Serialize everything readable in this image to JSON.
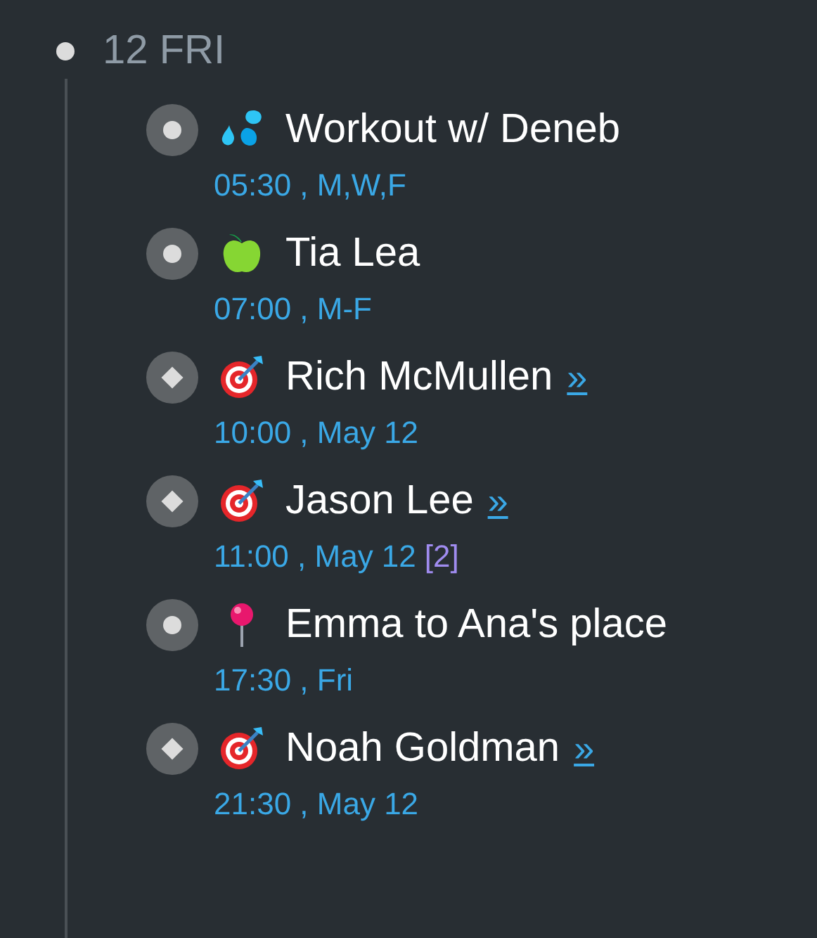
{
  "day": {
    "label": "12 FRI"
  },
  "items": [
    {
      "kind": "repeat",
      "title": "Workout w/ Deneb",
      "when": "05:30 , M,W,F"
    },
    {
      "kind": "repeat",
      "title": "Tia Lea",
      "when": "07:00 , M-F"
    },
    {
      "kind": "dated",
      "title": "Rich McMullen",
      "link": "»",
      "when": "10:00 , May 12"
    },
    {
      "kind": "dated",
      "title": "Jason Lee",
      "link": "»",
      "when": "11:00 , May 12",
      "count": "[2]"
    },
    {
      "kind": "repeat",
      "title": "Emma to Ana's place",
      "when": "17:30 , Fri"
    },
    {
      "kind": "dated",
      "title": "Noah Goldman",
      "link": "»",
      "when": "21:30 , May 12"
    }
  ]
}
